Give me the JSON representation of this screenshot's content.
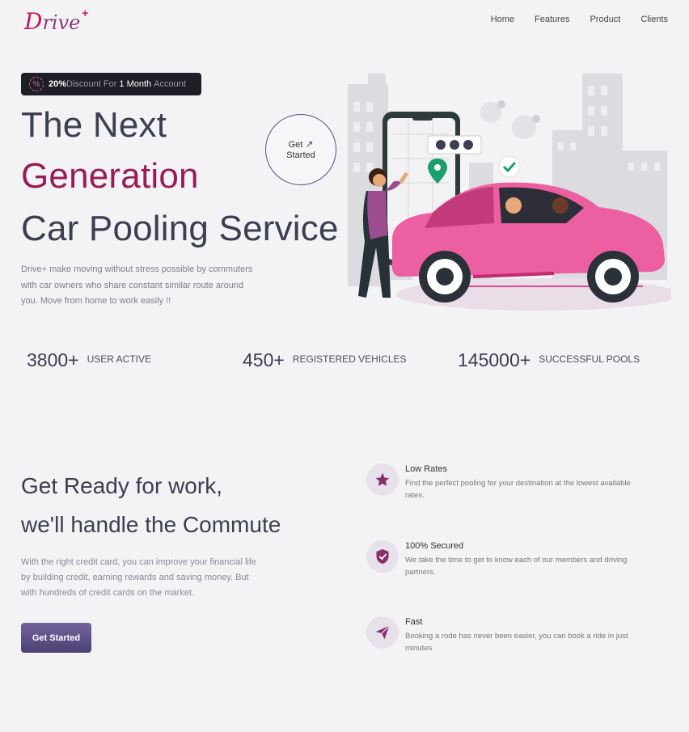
{
  "brand": {
    "logo_d": "D",
    "logo_rest": "riv",
    "logo_e": "e",
    "logo_plus": "+"
  },
  "nav": {
    "items": [
      "Home",
      "Features",
      "Product",
      "Clients"
    ]
  },
  "hero": {
    "badge": {
      "pct_symbol": "%",
      "pct": "20%",
      "text1": "Discount For",
      "bold2": "1 Month",
      "text3": "Account"
    },
    "title_line1": "The Next",
    "title_line2": "Generation",
    "title_line3": "Car Pooling Service",
    "description": "Drive+ make moving without stress possible by commuters with car owners who share constant similar route around you. Move from home to work easily !!",
    "cta_line1": "Get",
    "cta_line2": "Started",
    "cta_arrow": "↗"
  },
  "stats": [
    {
      "value": "3800+",
      "label": "USER ACTIVE"
    },
    {
      "value": "450+",
      "label": "REGISTERED VEHICLES"
    },
    {
      "value": "145000+",
      "label": "SUCCESSFUL POOLS"
    }
  ],
  "section2": {
    "heading_line1": "Get Ready for work,",
    "heading_line2": "we'll handle the Commute",
    "description": "With the right credit card, you can improve your financial life by building credit, earning rewards and saving money. But with hundreds of credit cards on the market.",
    "cta": "Get Started",
    "features": [
      {
        "icon": "star-icon",
        "title": "Low Rates",
        "text": "Find the perfect pooling for your destination at the lowest available rates."
      },
      {
        "icon": "shield-check-icon",
        "title": "100% Secured",
        "text": "We take the time to get to know each of our members and driving partners."
      },
      {
        "icon": "paper-plane-icon",
        "title": "Fast",
        "text": "Booking a rode has never been easier, you can book a ride in just minutes"
      }
    ]
  },
  "colors": {
    "accent": "#9a1c57",
    "brand": "#c2185b",
    "button": "#5a4d86",
    "text": "#3b3f4e"
  }
}
